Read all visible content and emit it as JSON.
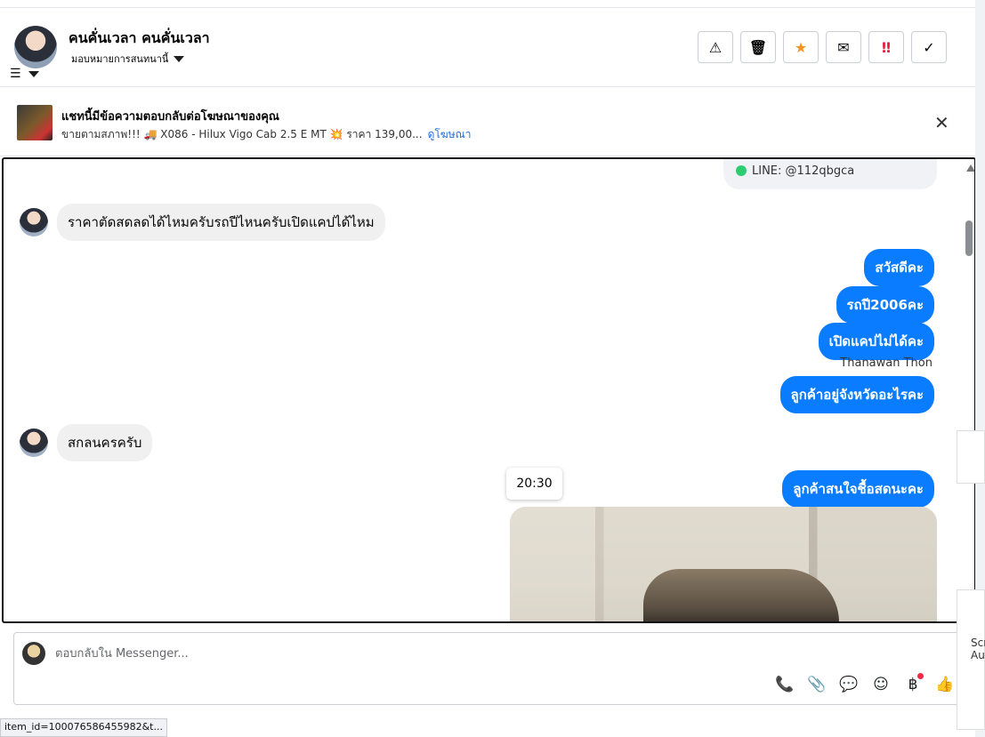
{
  "header": {
    "name": "คนคั่นเวลา คนคั่นเวลา",
    "assign_label": "มอบหมายการสนทนานี้",
    "actions": [
      {
        "icon": "⚠",
        "name": "report-button"
      },
      {
        "icon": "🗑",
        "name": "delete-button"
      },
      {
        "icon": "★",
        "name": "star-button"
      },
      {
        "icon": "✉",
        "name": "mark-unread-button"
      },
      {
        "icon": "‼",
        "name": "important-button"
      },
      {
        "icon": "✓",
        "name": "done-button"
      }
    ]
  },
  "ad": {
    "title": "แชทนี้มีข้อความตอบกลับต่อโฆษณาของคุณ",
    "desc": "ขายตามสภาพ!!! 🚚 X086 - Hilux Vigo Cab 2.5 E MT 💥 ราคา 139,00...",
    "link": "ดูโฆษณา"
  },
  "messages": {
    "line_id": "LINE: @112qbgca",
    "in1": "ราคาตัดสดลดได้ไหมครับรถปีไหนครับเปิดแคปได้ไหม",
    "out1": "สวัสดีคะ",
    "out2": "รถปี2006คะ",
    "out3": "เปิดแคปไม่ได้คะ",
    "sender": "Thanawan Thon",
    "out4": "ลูกค้าอยู่จังหวัดอะไรคะ",
    "in2": "สกลนครครับ",
    "time": "20:30",
    "out5": "ลูกค้าสนใจชื้อสดนะคะ"
  },
  "composer": {
    "placeholder": "ตอบกลับใน Messenger...",
    "tools": [
      "📞",
      "📎",
      "💬",
      "☺",
      "฿",
      "👍"
    ]
  },
  "statusbar": "item_id=100076586455982&t...",
  "side": {
    "text": "Scr Au"
  }
}
